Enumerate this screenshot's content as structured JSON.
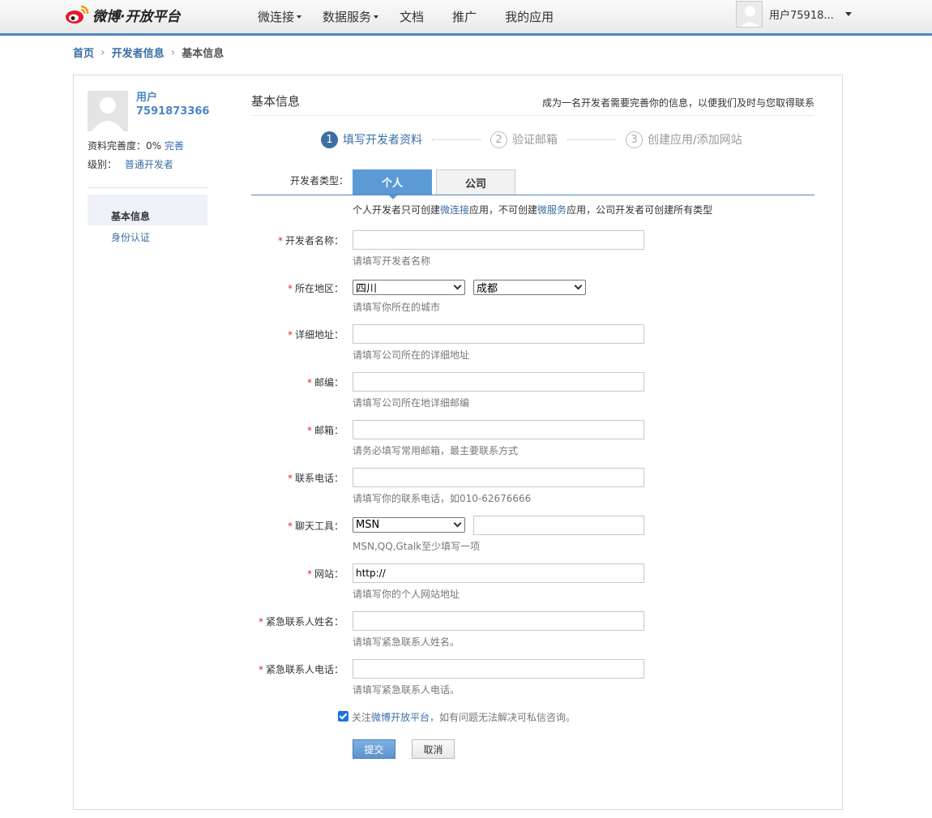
{
  "header": {
    "logo_text": "微博·开放平台",
    "nav": [
      {
        "label": "微连接",
        "dropdown": true
      },
      {
        "label": "数据服务",
        "dropdown": true
      },
      {
        "label": "文档",
        "dropdown": false
      },
      {
        "label": "推广",
        "dropdown": false
      },
      {
        "label": "我的应用",
        "dropdown": false
      }
    ],
    "user_name": "用户75918..."
  },
  "breadcrumb": {
    "home": "首页",
    "developer_info": "开发者信息",
    "current": "基本信息"
  },
  "sidebar": {
    "name_line1": "用户",
    "name_line2": "7591873366",
    "completeness_label": "资料完善度：0%",
    "complete_link": "完善",
    "level_label": "级别：",
    "level_value": "普通开发者",
    "items": [
      {
        "label": "基本信息",
        "active": true
      },
      {
        "label": "身份认证",
        "active": false
      }
    ]
  },
  "content": {
    "title": "基本信息",
    "tip": "成为一名开发者需要完善你的信息，以便我们及时与您取得联系",
    "steps": [
      {
        "num": "1",
        "label": "填写开发者资料",
        "active": true
      },
      {
        "num": "2",
        "label": "验证邮箱",
        "active": false
      },
      {
        "num": "3",
        "label": "创建应用/添加网站",
        "active": false
      }
    ],
    "dev_type_label": "开发者类型：",
    "tabs": [
      {
        "label": "个人",
        "active": true
      },
      {
        "label": "公司",
        "active": false
      }
    ],
    "type_desc_pre": "个人开发者只可创建",
    "type_desc_link1": "微连接",
    "type_desc_mid": "应用，不可创建",
    "type_desc_link2": "微服务",
    "type_desc_post": "应用，公司开发者可创建所有类型"
  },
  "form": {
    "dev_name": {
      "label": "开发者名称：",
      "value": "",
      "hint": "请填写开发者名称"
    },
    "region": {
      "label": "所在地区：",
      "province": "四川",
      "city": "成都",
      "hint": "请填写你所在的城市"
    },
    "address": {
      "label": "详细地址：",
      "value": "",
      "hint": "请填写公司所在的详细地址"
    },
    "zip": {
      "label": "邮编：",
      "value": "",
      "hint": "请填写公司所在地详细邮编"
    },
    "email": {
      "label": "邮箱：",
      "value": "",
      "hint": "请务必填写常用邮箱，最主要联系方式"
    },
    "phone": {
      "label": "联系电话：",
      "value": "",
      "hint": "请填写你的联系电话，如010-62676666"
    },
    "chat": {
      "label": "聊天工具：",
      "tool": "MSN",
      "value": "",
      "hint": "MSN,QQ,Gtalk至少填写一项"
    },
    "website": {
      "label": "网站：",
      "value": "http://",
      "hint": "请填写你的个人网站地址"
    },
    "emergency_name": {
      "label": "紧急联系人姓名：",
      "value": "",
      "hint": "请填写紧急联系人姓名。"
    },
    "emergency_phone": {
      "label": "紧急联系人电话：",
      "value": "",
      "hint": "请填写紧急联系人电话。"
    },
    "required_mark": "*",
    "follow_pre": "关注",
    "follow_link": "微博开放平台",
    "follow_post": "，如有问题无法解决可私信咨询。",
    "follow_checked": true,
    "submit": "提交",
    "cancel": "取消"
  },
  "colors": {
    "accent": "#4a86c5",
    "link": "#3b6ea5",
    "required": "#e02a2a"
  }
}
